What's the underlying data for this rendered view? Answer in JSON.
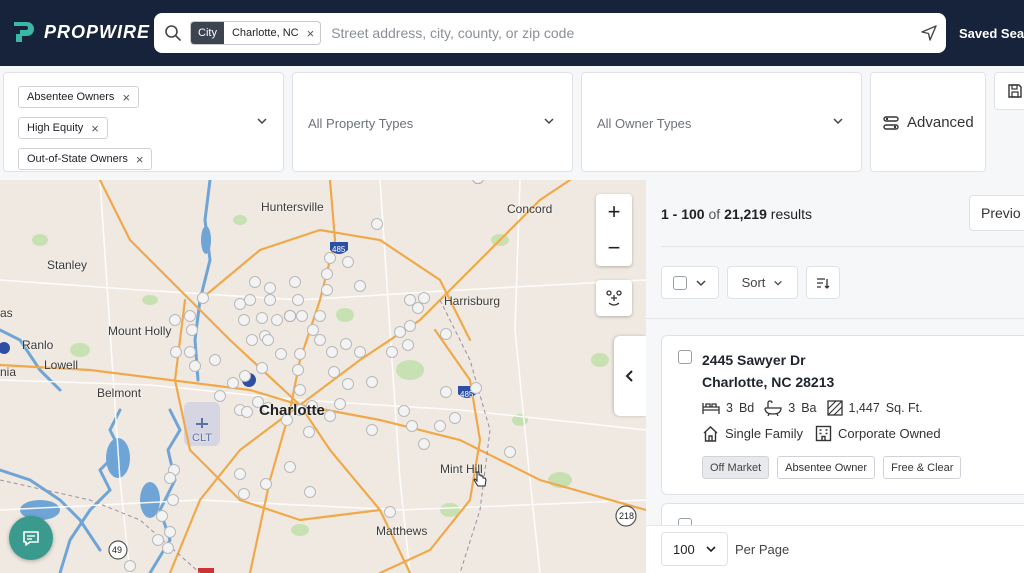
{
  "header": {
    "logo_text": "PROPWIRE",
    "search": {
      "chip_tag": "City",
      "chip_value": "Charlotte, NC",
      "chip_remove": "×",
      "placeholder": "Street address, city, county, or zip code"
    },
    "saved_searches_label": "Saved Sear"
  },
  "filters": {
    "owner_filters": [
      {
        "label": "Absentee Owners",
        "remove": "×"
      },
      {
        "label": "High Equity",
        "remove": "×"
      },
      {
        "label": "Out-of-State Owners",
        "remove": "×"
      }
    ],
    "property_types_placeholder": "All Property Types",
    "owner_types_placeholder": "All Owner Types",
    "advanced_label": "Advanced"
  },
  "map": {
    "zoom_in": "+",
    "zoom_out": "−",
    "labels": [
      {
        "text": "Huntersville"
      },
      {
        "text": "Concord"
      },
      {
        "text": "Stanley"
      },
      {
        "text": "Harrisburg"
      },
      {
        "text": "Mount Holly"
      },
      {
        "text": "Ranlo"
      },
      {
        "text": "Lowell"
      },
      {
        "text": "nia"
      },
      {
        "text": "as"
      },
      {
        "text": "Belmont"
      },
      {
        "text": "Charlotte"
      },
      {
        "text": "CLT"
      },
      {
        "text": "Mint Hill"
      },
      {
        "text": "Matthews"
      }
    ],
    "shields": [
      "485",
      "485",
      "218",
      "49"
    ]
  },
  "results": {
    "range": "1 - 100",
    "of": "of",
    "total": "21,219",
    "suffix": "results",
    "previous_label": "Previo",
    "sort_label": "Sort",
    "listing": {
      "address_line1": "2445 Sawyer Dr",
      "address_line2": "Charlotte, NC 28213",
      "beds": "3",
      "beds_label": "Bd",
      "baths": "3",
      "baths_label": "Ba",
      "sqft": "1,447",
      "sqft_label": "Sq. Ft.",
      "property_type": "Single Family",
      "ownership": "Corporate Owned",
      "tags": [
        "Off Market",
        "Absentee Owner",
        "Free & Clear"
      ]
    },
    "per_page_value": "100",
    "per_page_label": "Per Page"
  },
  "colors": {
    "nav_bg": "#16233a",
    "accent_teal": "#3a9a8e",
    "map_land": "#efe9e1",
    "water": "#6fa5d6",
    "park": "#b9dca0",
    "road_major": "#f0a94a"
  }
}
